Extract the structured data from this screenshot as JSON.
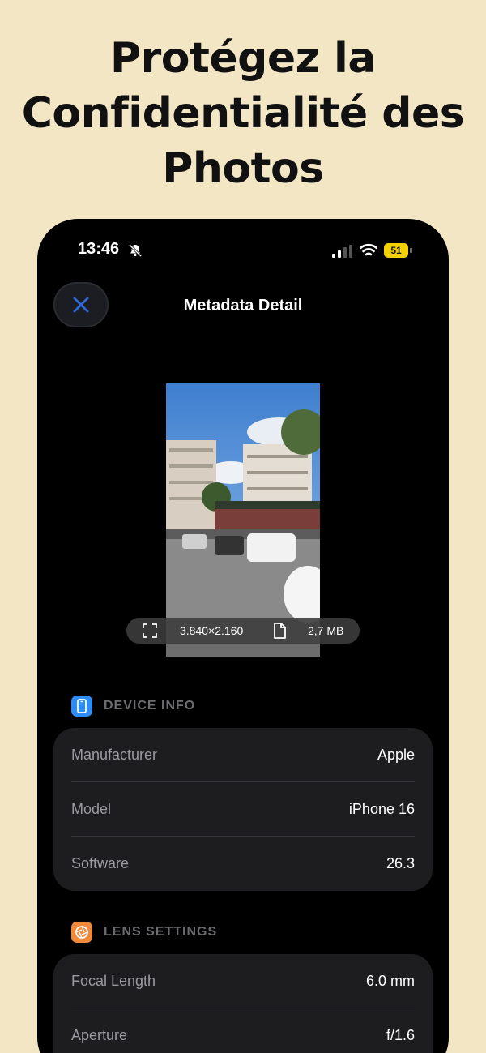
{
  "headline": {
    "line1": "Protégez la",
    "line2": "Confidentialité des",
    "line3": "Photos"
  },
  "status_bar": {
    "time": "13:46",
    "battery": "51",
    "battery_color": "#f4d100"
  },
  "nav": {
    "title": "Metadata Detail",
    "close_icon": "close-icon"
  },
  "photo": {
    "resolution": "3.840×2.160",
    "file_size": "2,7 MB"
  },
  "sections": {
    "device": {
      "title": "DEVICE INFO",
      "icon": "phone-icon",
      "icon_color": "#2f8cf6",
      "rows": [
        {
          "label": "Manufacturer",
          "value": "Apple"
        },
        {
          "label": "Model",
          "value": "iPhone 16"
        },
        {
          "label": "Software",
          "value": "26.3"
        }
      ]
    },
    "lens": {
      "title": "LENS SETTINGS",
      "icon": "aperture-icon",
      "icon_color": "#f08a3a",
      "rows": [
        {
          "label": "Focal Length",
          "value": "6.0 mm"
        },
        {
          "label": "Aperture",
          "value": "f/1.6"
        }
      ]
    }
  }
}
